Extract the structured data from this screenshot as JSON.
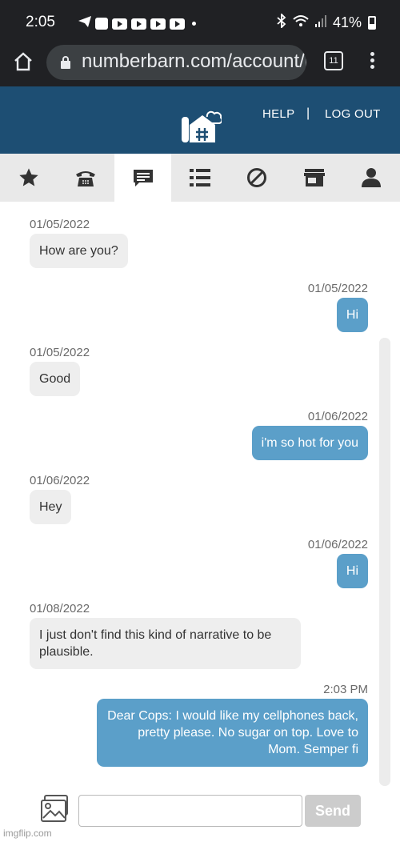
{
  "status_bar": {
    "time": "2:05",
    "battery": "41%"
  },
  "browser": {
    "url": "numberbarn.com/account/messages",
    "tab_count": "11"
  },
  "header": {
    "help": "HELP",
    "separator": "|",
    "logout": "LOG OUT"
  },
  "nav": {
    "tabs": [
      {
        "icon": "star-icon",
        "active": false
      },
      {
        "icon": "phone-icon",
        "active": false
      },
      {
        "icon": "message-icon",
        "active": true
      },
      {
        "icon": "list-icon",
        "active": false
      },
      {
        "icon": "block-icon",
        "active": false
      },
      {
        "icon": "store-icon",
        "active": false
      },
      {
        "icon": "user-icon",
        "active": false
      }
    ]
  },
  "messages": [
    {
      "date": "01/05/2022",
      "text": "How are you?",
      "direction": "in"
    },
    {
      "date": "01/05/2022",
      "text": "Hi",
      "direction": "out"
    },
    {
      "date": "01/05/2022",
      "text": "Good",
      "direction": "in"
    },
    {
      "date": "01/06/2022",
      "text": "i'm so hot for you",
      "direction": "out"
    },
    {
      "date": "01/06/2022",
      "text": "Hey",
      "direction": "in"
    },
    {
      "date": "01/06/2022",
      "text": "Hi",
      "direction": "out"
    },
    {
      "date": "01/08/2022",
      "text": "I just don't find this kind of narrative to be plausible.",
      "direction": "in"
    },
    {
      "date": "2:03 PM",
      "text": "Dear Cops: I would like my cellphones back, pretty please. No sugar on top. Love to Mom. Semper fi",
      "direction": "out"
    }
  ],
  "composer": {
    "placeholder": "",
    "send_label": "Send"
  },
  "watermark": "imgflip.com",
  "colors": {
    "header": "#1d4e73",
    "outgoing_bubble": "#5b9fc9",
    "incoming_bubble": "#eeeeee"
  }
}
